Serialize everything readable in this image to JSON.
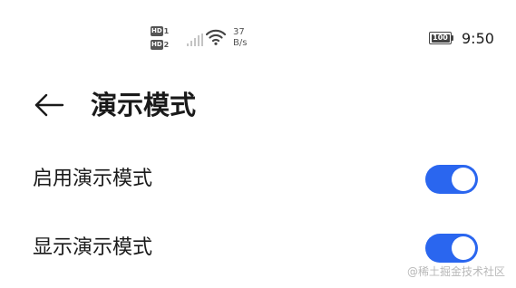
{
  "status_bar": {
    "hd1": {
      "label": "HD",
      "num": "1"
    },
    "hd2": {
      "label": "HD",
      "num": "2"
    },
    "net_speed_value": "37",
    "net_speed_unit": "B/s",
    "battery_level": "100",
    "time": "9:50"
  },
  "header": {
    "back_icon": "arrow-left-icon",
    "title": "演示模式"
  },
  "settings": [
    {
      "label": "启用演示模式",
      "enabled": true
    },
    {
      "label": "显示演示模式",
      "enabled": true
    }
  ],
  "colors": {
    "toggle_on": "#2a66ef"
  },
  "watermark": "@稀土掘金技术社区"
}
